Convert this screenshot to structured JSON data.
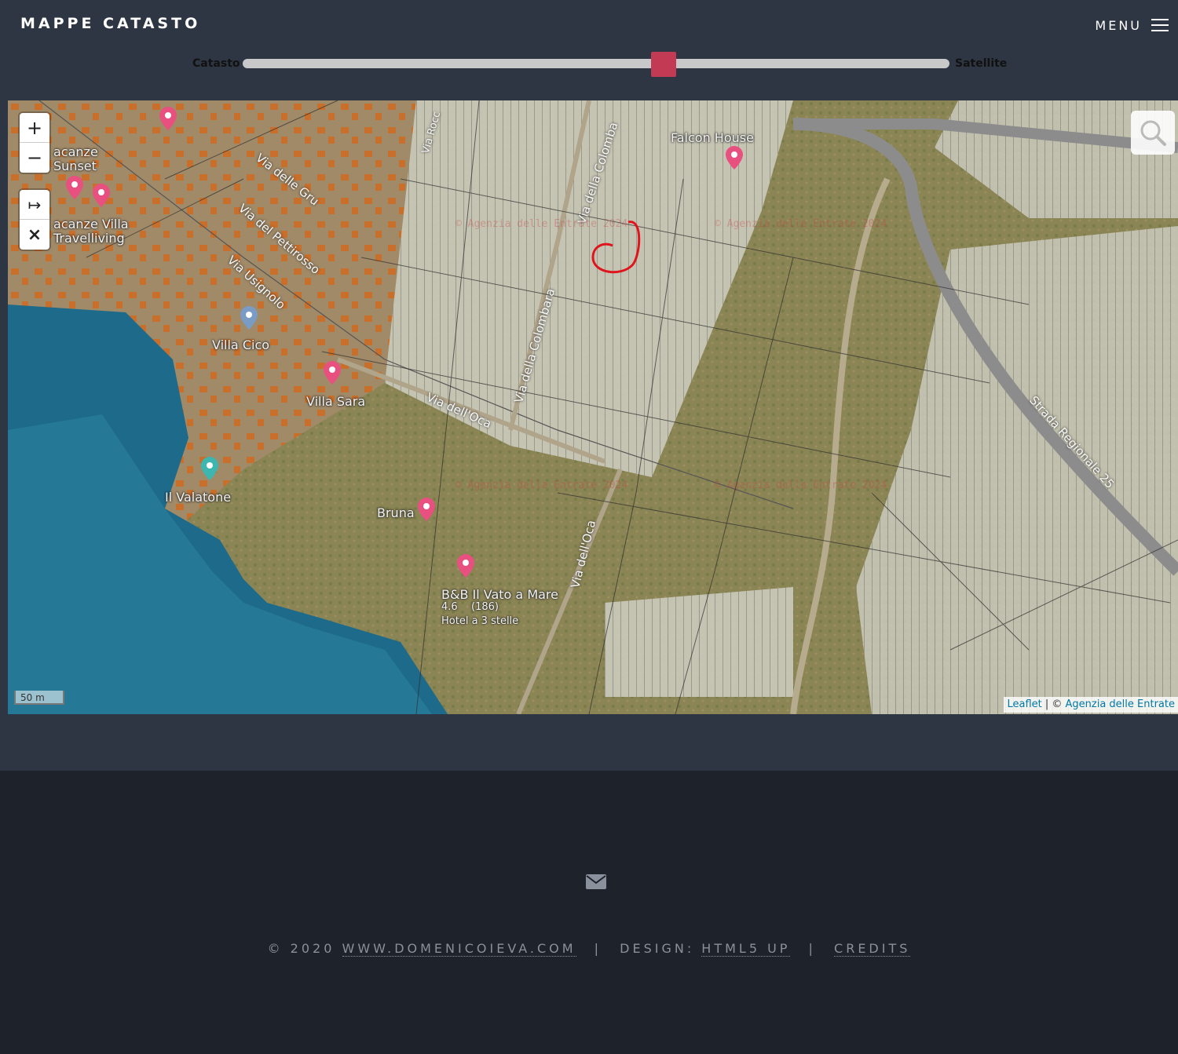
{
  "header": {
    "site_title": "MAPPE CATASTO",
    "menu_label": "MENU"
  },
  "slider": {
    "left_label": "Catasto",
    "right_label": "Satellite",
    "value_fraction": 0.6
  },
  "map": {
    "zoom_in": "+",
    "zoom_out": "−",
    "measure": "↦",
    "clear": "×",
    "scale_label": "50 m",
    "attribution": {
      "leaflet": "Leaflet",
      "separator": " | © ",
      "source": "Agenzia delle Entrate"
    },
    "places": [
      "acanze",
      "Sunset",
      "acanze Villa",
      "Travelliving",
      "Villa Cico",
      "Villa Sara",
      "Il Valatone",
      "Bruna",
      "B&B Il Vato a Mare",
      "4.6",
      "(186)",
      "Hotel a 3 stelle",
      "Falcon House"
    ],
    "streets": [
      "Via delle Gru",
      "Via del Pettirosso",
      "Via Usignolo",
      "Via della Colomba",
      "Via della Colombara",
      "Via dell'Oca",
      "Via dell'Oca",
      "Strada Regionale 25",
      "Via Rocc"
    ],
    "watermarks": [
      "© Agenzia delle Entrate 2024",
      "© Agenzia delle Entrate 2024",
      "© Agenzia delle Entrate 2024",
      "© Agenzia delle Entrate 2024"
    ],
    "annotation_color": "#e0141c",
    "icons": [
      "plus-icon",
      "minus-icon",
      "measure-icon",
      "close-icon",
      "search-icon",
      "map-pin-icon"
    ]
  },
  "footer": {
    "copyright": "© 2020",
    "site_link": "WWW.DOMENICOIEVA.COM",
    "divider": "|",
    "design_label": "DESIGN:",
    "design_link": "HTML5 UP",
    "credits_link": "CREDITS"
  },
  "colors": {
    "header_bg": "#2e3643",
    "footer_bg": "#1d222b",
    "slider_thumb": "#c23a53",
    "sea": "#1e6a8a"
  }
}
